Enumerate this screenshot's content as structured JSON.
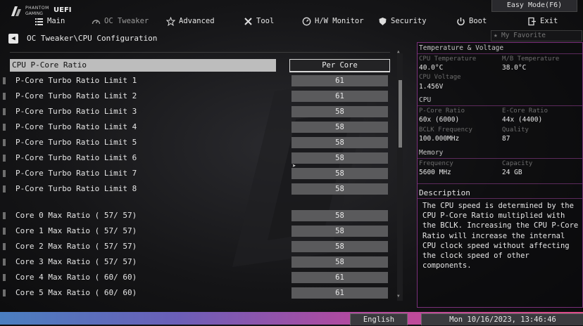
{
  "app": {
    "brand_line1": "PHANTOM",
    "brand_line2": "GAMING",
    "brand_uefi": "UEFI",
    "easy_mode": "Easy Mode(F6)"
  },
  "nav": [
    {
      "label": "Main",
      "icon": "list-icon"
    },
    {
      "label": "OC Tweaker",
      "icon": "speedometer-icon"
    },
    {
      "label": "Advanced",
      "icon": "star-icon"
    },
    {
      "label": "Tool",
      "icon": "tools-icon"
    },
    {
      "label": "H/W Monitor",
      "icon": "monitor-icon"
    },
    {
      "label": "Security",
      "icon": "shield-icon"
    },
    {
      "label": "Boot",
      "icon": "power-icon"
    },
    {
      "label": "Exit",
      "icon": "exit-icon"
    }
  ],
  "breadcrumb": "OC Tweaker\\CPU Configuration",
  "favorite_label": "My Favorite",
  "settings": {
    "selected": {
      "label": "CPU P-Core Ratio",
      "value": "Per Core"
    },
    "group1": [
      {
        "label": "P-Core Turbo Ratio Limit 1",
        "value": "61"
      },
      {
        "label": "P-Core Turbo Ratio Limit 2",
        "value": "61"
      },
      {
        "label": "P-Core Turbo Ratio Limit 3",
        "value": "58"
      },
      {
        "label": "P-Core Turbo Ratio Limit 4",
        "value": "58"
      },
      {
        "label": "P-Core Turbo Ratio Limit 5",
        "value": "58"
      },
      {
        "label": "P-Core Turbo Ratio Limit 6",
        "value": "58"
      },
      {
        "label": "P-Core Turbo Ratio Limit 7",
        "value": "58"
      },
      {
        "label": "P-Core Turbo Ratio Limit 8",
        "value": "58"
      }
    ],
    "group2": [
      {
        "label": "Core 0 Max Ratio ( 57/ 57)",
        "value": "58"
      },
      {
        "label": "Core 1 Max Ratio ( 57/ 57)",
        "value": "58"
      },
      {
        "label": "Core 2 Max Ratio ( 57/ 57)",
        "value": "58"
      },
      {
        "label": "Core 3 Max Ratio ( 57/ 57)",
        "value": "58"
      },
      {
        "label": "Core 4 Max Ratio ( 60/ 60)",
        "value": "61"
      },
      {
        "label": "Core 5 Max Ratio ( 60/ 60)",
        "value": "61"
      }
    ]
  },
  "info_panel": {
    "temp_heading": "Temperature & Voltage",
    "cpu_temp_label": "CPU Temperature",
    "cpu_temp_value": "40.0°C",
    "mb_temp_label": "M/B Temperature",
    "mb_temp_value": "38.0°C",
    "cpu_volt_label": "CPU Voltage",
    "cpu_volt_value": "1.456V",
    "cpu_heading": "CPU",
    "pcore_label": "P-Core Ratio",
    "pcore_value": "60x (6000)",
    "ecore_label": "E-Core Ratio",
    "ecore_value": "44x (4400)",
    "bclk_label": "BCLK Frequency",
    "bclk_value": "100.000MHz",
    "quality_label": "Quality",
    "quality_value": "87",
    "mem_heading": "Memory",
    "freq_label": "Frequency",
    "freq_value": "5600 MHz",
    "cap_label": "Capacity",
    "cap_value": "24 GB",
    "desc_title": "Description",
    "desc_text": "The CPU speed is determined by the CPU P-Core Ratio multiplied with the BCLK. Increasing the CPU P-Core Ratio will increase the internal CPU clock speed without affecting the clock speed of other components."
  },
  "footer": {
    "language": "English",
    "datetime": "Mon 10/16/2023, 13:46:46"
  },
  "colors": {
    "accent": "#7a2f7a",
    "selected_bg": "#bdbdbd",
    "value_bg": "#5a5a5c"
  }
}
